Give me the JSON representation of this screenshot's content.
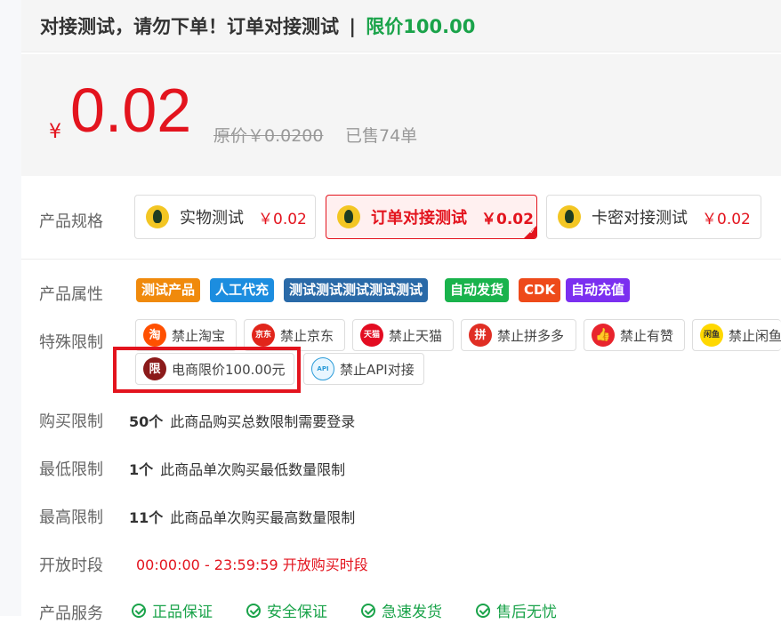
{
  "header": {
    "title": "对接测试，请勿下单！订单对接测试",
    "separator": "|",
    "limit": "限价100.00"
  },
  "price": {
    "currency": "¥",
    "current": "0.02",
    "original": "原价￥0.0200",
    "sold": "已售74单"
  },
  "labels": {
    "spec": "产品规格",
    "attrs": "产品属性",
    "restrictions": "特殊限制",
    "buy_limit": "购买限制",
    "min_limit": "最低限制",
    "max_limit": "最高限制",
    "open_time": "开放时段",
    "services": "产品服务"
  },
  "specs": [
    {
      "name": "实物测试",
      "price": "￥0.02",
      "selected": false
    },
    {
      "name": "订单对接测试",
      "price": "￥0.02",
      "selected": true
    },
    {
      "name": "卡密对接测试",
      "price": "￥0.02",
      "selected": false
    }
  ],
  "attributes": [
    {
      "label": "测试产品",
      "color": "#f08a0c"
    },
    {
      "label": "人工代充",
      "color": "#1c8ddf"
    },
    {
      "label": "测试测试测试测试测试",
      "color": "#2a6aa8"
    },
    {
      "label": "自动发货",
      "color": "#19b34c"
    },
    {
      "label": "CDK",
      "color": "#ee4a1a"
    },
    {
      "label": "自动充值",
      "color": "#7b2ff0"
    }
  ],
  "restrictions": [
    {
      "label": "禁止淘宝",
      "icon": "taobao-icon",
      "glyph": "淘",
      "color": "#ff5000"
    },
    {
      "label": "禁止京东",
      "icon": "jd-icon",
      "glyph": "京东",
      "color": "#e1251b"
    },
    {
      "label": "禁止天猫",
      "icon": "tmall-icon",
      "glyph": "天猫",
      "color": "#e30c21"
    },
    {
      "label": "禁止拼多多",
      "icon": "pinduoduo-icon",
      "glyph": "拼",
      "color": "#e02e24"
    },
    {
      "label": "禁止有赞",
      "icon": "youzan-icon",
      "glyph": "👍",
      "color": "#e8242d"
    },
    {
      "label": "禁止闲鱼",
      "icon": "xianyu-icon",
      "glyph": "闲鱼",
      "color": "#ffd800"
    },
    {
      "label": "电商限价100.00元",
      "icon": "price-limit-icon",
      "glyph": "限",
      "color": "#8b1a1a"
    },
    {
      "label": "禁止API对接",
      "icon": "api-icon",
      "glyph": "API",
      "color": "#e8f6ff"
    }
  ],
  "limits": {
    "buy_count": "50个",
    "buy_desc": "此商品购买总数限制需要登录",
    "min_count": "1个",
    "min_desc": "此商品单次购买最低数量限制",
    "max_count": "11个",
    "max_desc": "此商品单次购买最高数量限制",
    "open_time": "00:00:00 - 23:59:59 开放购买时段"
  },
  "services": [
    "正品保证",
    "安全保证",
    "急速发货",
    "售后无忧"
  ],
  "colors": {
    "accent": "#e3141e",
    "green": "#1aa34a"
  }
}
